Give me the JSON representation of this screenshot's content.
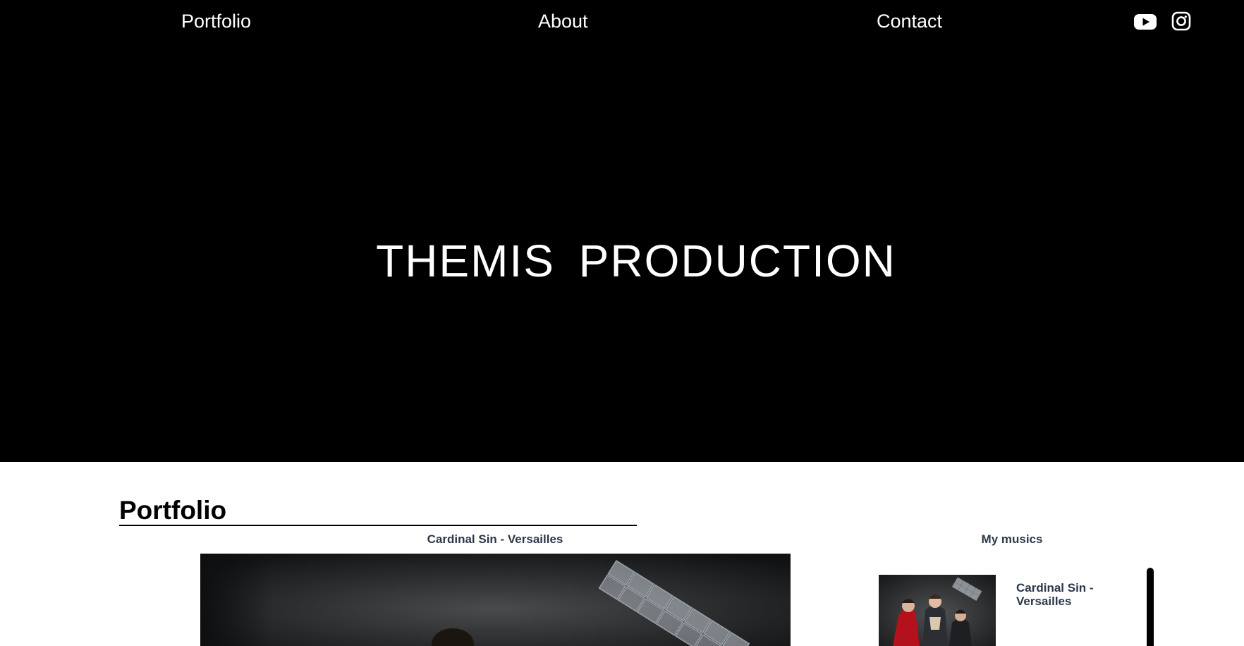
{
  "nav": {
    "links": [
      "Portfolio",
      "About",
      "Contact"
    ],
    "social_icons": [
      "youtube-icon",
      "instagram-icon"
    ]
  },
  "hero": {
    "title": "THEMIS PRODUCTION"
  },
  "portfolio": {
    "heading": "Portfolio",
    "player_title": "Cardinal Sin - Versailles"
  },
  "playlist": {
    "heading": "My musics",
    "items": [
      {
        "title": "Cardinal Sin - Versailles"
      }
    ]
  },
  "colors": {
    "hero_bg": "#000000",
    "text_dark": "#2d3748"
  }
}
